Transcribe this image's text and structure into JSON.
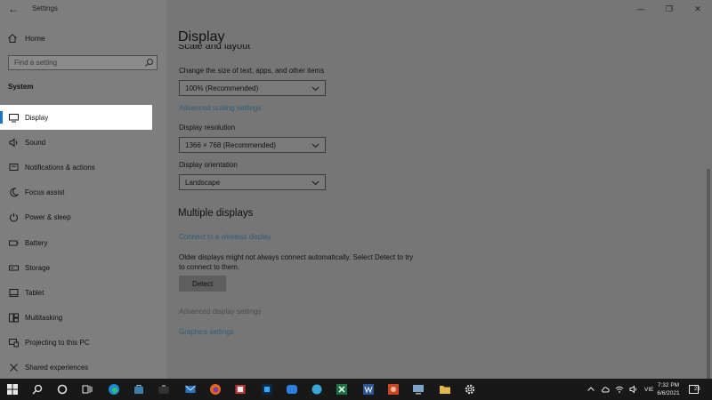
{
  "window": {
    "title": "Settings",
    "back_glyph": "←",
    "controls": {
      "minimize": "—",
      "maximize": "❐",
      "close": "✕"
    }
  },
  "sidebar": {
    "home_label": "Home",
    "search_placeholder": "Find a setting",
    "section_label": "System",
    "items": [
      {
        "label": "Display",
        "icon": "monitor-icon",
        "selected": true
      },
      {
        "label": "Sound",
        "icon": "speaker-icon"
      },
      {
        "label": "Notifications & actions",
        "icon": "notification-icon"
      },
      {
        "label": "Focus assist",
        "icon": "moon-icon"
      },
      {
        "label": "Power & sleep",
        "icon": "power-icon"
      },
      {
        "label": "Battery",
        "icon": "battery-icon"
      },
      {
        "label": "Storage",
        "icon": "storage-icon"
      },
      {
        "label": "Tablet",
        "icon": "tablet-icon"
      },
      {
        "label": "Multitasking",
        "icon": "multitasking-icon"
      },
      {
        "label": "Projecting to this PC",
        "icon": "projector-icon"
      },
      {
        "label": "Shared experiences",
        "icon": "shared-icon"
      }
    ]
  },
  "main": {
    "page_title": "Display",
    "cut_heading": "Scale and layout",
    "scale_label": "Change the size of text, apps, and other items",
    "scale_value": "100% (Recommended)",
    "advanced_scaling_link": "Advanced scaling settings",
    "resolution_label": "Display resolution",
    "resolution_value": "1366 × 768 (Recommended)",
    "orientation_label": "Display orientation",
    "orientation_value": "Landscape",
    "multiple_displays_heading": "Multiple displays",
    "wireless_link": "Connect to a wireless display",
    "older_displays_text": "Older displays might not always connect automatically. Select Detect to try to connect to them.",
    "detect_button": "Detect",
    "advanced_display_link": "Advanced display settings",
    "graphics_link": "Graphics settings"
  },
  "taskbar": {
    "apps": [
      "windows-start-icon",
      "search-icon",
      "cortana-icon",
      "task-view-icon",
      "edge-icon",
      "store-bag-icon",
      "briefcase-icon",
      "mail-icon",
      "firefox-icon",
      "app-icon",
      "photoshop-icon",
      "zalo-icon",
      "app-icon",
      "excel-icon",
      "word-icon",
      "powerpoint-icon",
      "pc-icon",
      "folder-icon",
      "settings-gear-icon"
    ],
    "language": "VIE",
    "time": "7:32 PM",
    "date": "6/6/2021",
    "notification_count": "23",
    "colors": {
      "accent": "#1a73c6",
      "taskbar": "#181818"
    }
  }
}
